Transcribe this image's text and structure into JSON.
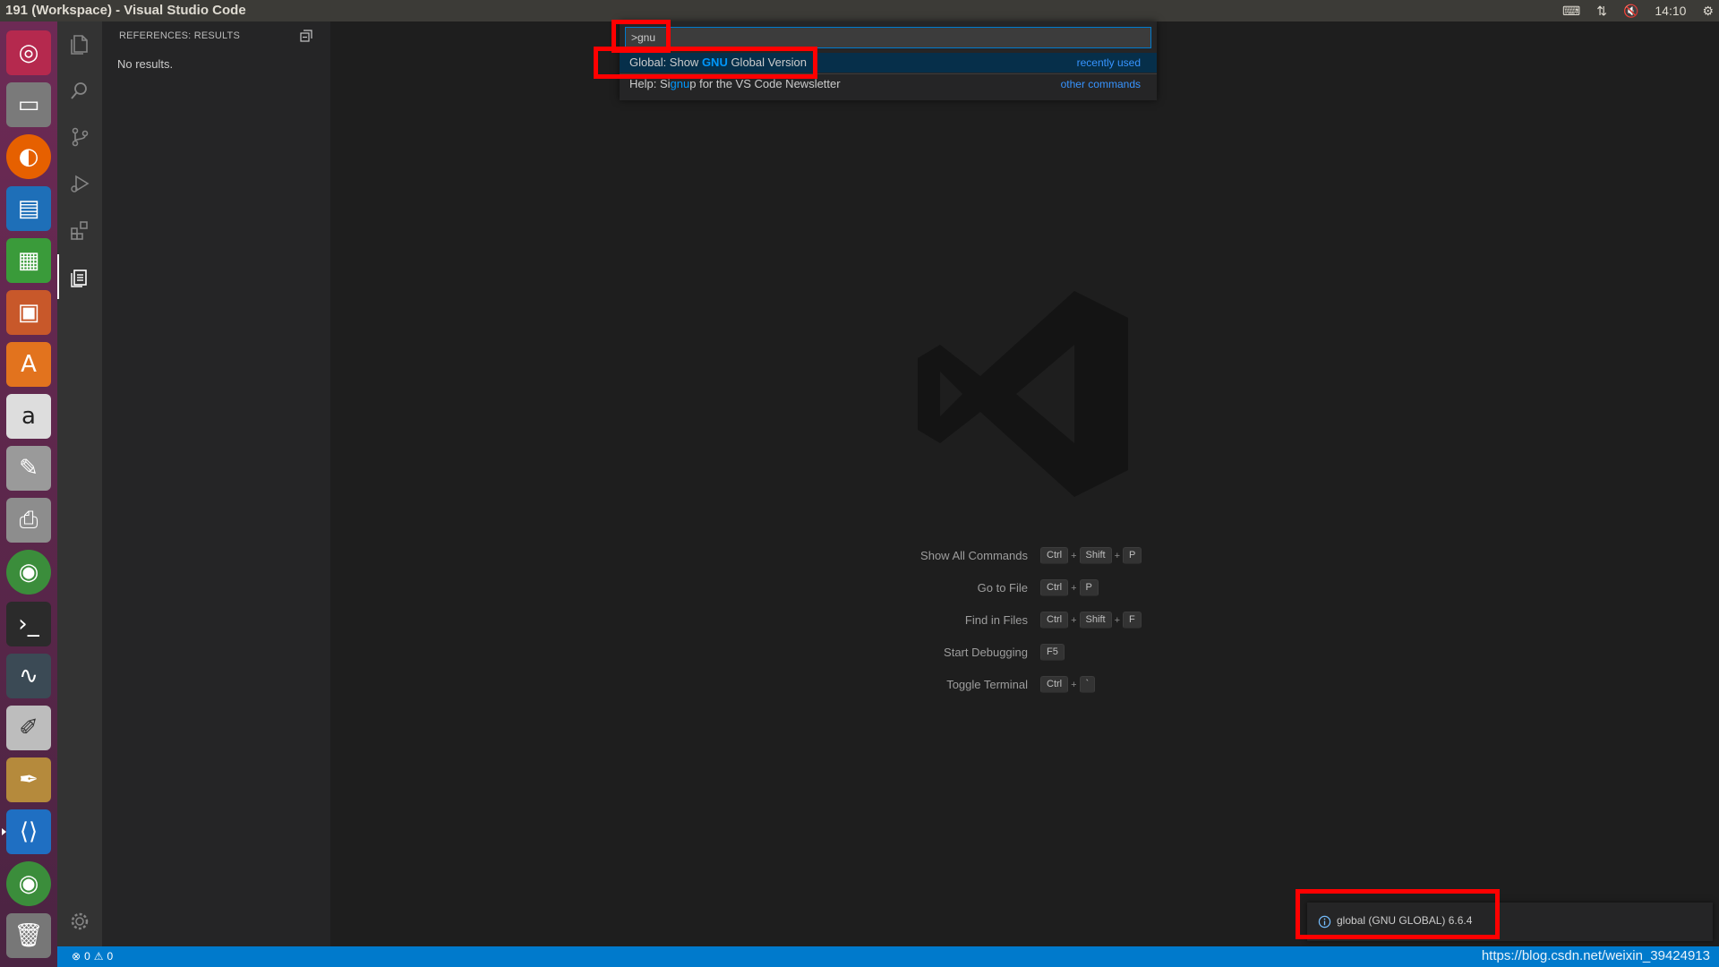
{
  "window": {
    "title": "191 (Workspace) - Visual Studio Code",
    "clock": "14:10"
  },
  "sidebar": {
    "header": "REFERENCES: RESULTS",
    "empty_text": "No results."
  },
  "palette": {
    "input_value": ">gnu",
    "items": [
      {
        "prefix": "Global: Show ",
        "highlight": "GNU",
        "suffix": " Global Version",
        "side": "recently used"
      },
      {
        "prefix": "Help: Si",
        "highlight": "gnu",
        "suffix": "p for the VS Code Newsletter",
        "side": "other commands"
      }
    ]
  },
  "shortcuts": [
    {
      "label": "Show All Commands",
      "keys": [
        "Ctrl",
        "Shift",
        "P"
      ]
    },
    {
      "label": "Go to File",
      "keys": [
        "Ctrl",
        "P"
      ]
    },
    {
      "label": "Find in Files",
      "keys": [
        "Ctrl",
        "Shift",
        "F"
      ]
    },
    {
      "label": "Start Debugging",
      "keys": [
        "F5"
      ]
    },
    {
      "label": "Toggle Terminal",
      "keys": [
        "Ctrl",
        "`"
      ]
    }
  ],
  "notification": {
    "message": "global (GNU GLOBAL) 6.6.4"
  },
  "status": {
    "errors": "0",
    "warnings": "0",
    "watermark": "https://blog.csdn.net/weixin_39424913"
  },
  "colors": {
    "accent": "#007acc",
    "highlight": "#0097fb",
    "annotation": "#ff0000"
  }
}
